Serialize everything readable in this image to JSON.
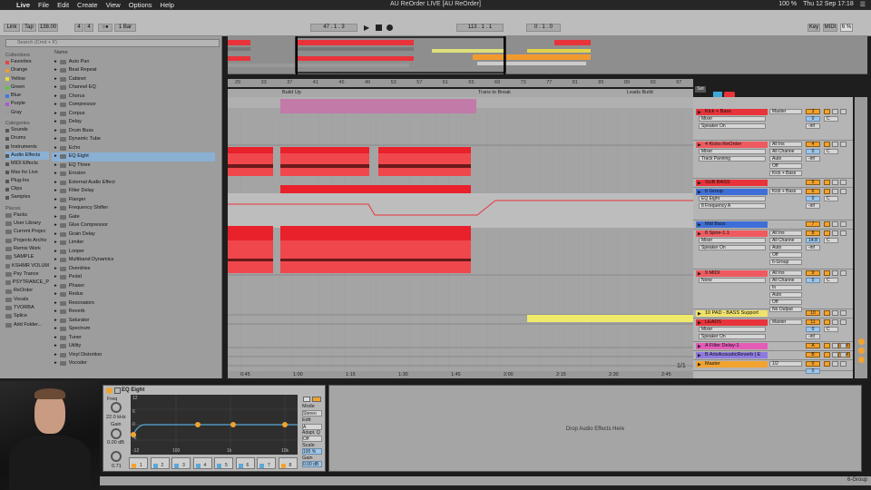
{
  "menubar": {
    "apple": "",
    "app": "Live",
    "items": [
      "File",
      "Edit",
      "Create",
      "View",
      "Options",
      "Help"
    ],
    "title": "AU ReOrder LIVE  [AU ReOrder]",
    "right": {
      "battery": "100 %",
      "clock": "Thu 12 Sep  17:18"
    }
  },
  "transport": {
    "link": "Link",
    "tap": "Tap",
    "tempo": "138.00",
    "sig_num": "4",
    "sig_den": "4",
    "metro": "1 Bar",
    "position": "47 .   1 .   3",
    "loop_start": "113 .   1 .   1",
    "loop_len": "0 .   1 .   0",
    "key": "Key",
    "midi": "MIDI",
    "cpu": "6 %"
  },
  "browser": {
    "search_placeholder": "Search (Cmd + F)",
    "collections_header": "Collections",
    "collections": [
      {
        "label": "Favorites",
        "color": "#e8453c"
      },
      {
        "label": "Orange",
        "color": "#f29a2e"
      },
      {
        "label": "Yellow",
        "color": "#eadb3c"
      },
      {
        "label": "Green",
        "color": "#5cc24a"
      },
      {
        "label": "Blue",
        "color": "#3f7ae0"
      },
      {
        "label": "Purple",
        "color": "#a85bd6"
      },
      {
        "label": "Gray",
        "color": "#9a9a9a"
      }
    ],
    "categories_header": "Categories",
    "categories": [
      "Sounds",
      "Drums",
      "Instruments",
      "Audio Effects",
      "MIDI Effects",
      "Max for Live",
      "Plug-Ins",
      "Clips",
      "Samples"
    ],
    "selected_category": "Audio Effects",
    "places_header": "Places",
    "places": [
      "Packs",
      "User Library",
      "Current Projec",
      "Projects Archiv",
      "Remix Work",
      "SAMPLE",
      "KSHMR VOLUM",
      "Psy Trance",
      "PSYTRANCE_P",
      "ReOrder",
      "Vocals",
      "TVORBA",
      "Splice",
      "Add Folder..."
    ],
    "list_header": "Name",
    "list": [
      "Auto Pan",
      "Beat Repeat",
      "Cabinet",
      "Channel EQ",
      "Chorus",
      "Compressor",
      "Corpus",
      "Delay",
      "Drum Buss",
      "Dynamic Tube",
      "Echo",
      "EQ Eight",
      "EQ Three",
      "Erosion",
      "External Audio Effect",
      "Filter Delay",
      "Flanger",
      "Frequency Shifter",
      "Gate",
      "Glue Compressor",
      "Grain Delay",
      "Limiter",
      "Looper",
      "Multiband Dynamics",
      "Overdrive",
      "Pedal",
      "Phaser",
      "Redux",
      "Resonators",
      "Reverb",
      "Saturator",
      "Spectrum",
      "Tuner",
      "Utility",
      "Vinyl Distortion",
      "Vocoder"
    ],
    "selected_item": "EQ Eight"
  },
  "arrangement": {
    "ruler": [
      "29",
      "33",
      "37",
      "41",
      "45",
      "49",
      "53",
      "57",
      "61",
      "65",
      "69",
      "73",
      "77",
      "81",
      "85",
      "89",
      "93",
      "97"
    ],
    "locators": [
      "Build Up",
      "Trans to Break",
      "Leads Build"
    ],
    "set_label": "Set",
    "time_ruler": [
      "0:45",
      "1:00",
      "1:15",
      "1:30",
      "1:45",
      "2:00",
      "2:15",
      "2:30",
      "2:45"
    ],
    "zoom_label": "1/1"
  },
  "mixer": {
    "tracks": [
      {
        "name": "Kick + Bass",
        "color": "#e8333a",
        "input": "Master",
        "routing": [
          "Mixer",
          "Speaker On"
        ],
        "num": "3",
        "vol": "0",
        "pan": "C",
        "send": "-inf"
      },
      {
        "name": "4 Kicks ReOrder",
        "color": "#ee5a5f",
        "input": "All Ins",
        "routing": [
          "Mixer",
          "Track Panning"
        ],
        "extra": [
          "All Channe",
          "Auto",
          "Off",
          "Kick + Bass"
        ],
        "num": "4",
        "vol": "0",
        "pan": "C",
        "send": "-inf"
      },
      {
        "name": "SUB BASS",
        "color": "#e8333a",
        "num": "5"
      },
      {
        "name": "6 Group",
        "color": "#3e6fd8",
        "input": "Kick + Bass",
        "routing": [
          "EQ Eight",
          "8 Frequency A"
        ],
        "num": "6",
        "vol": "0",
        "pan": "C",
        "send": "-inf"
      },
      {
        "name": "Mid Bass",
        "color": "#3e6fd8",
        "num": "7"
      },
      {
        "name": "8 Spire-1.1",
        "color": "#ee5a5f",
        "input": "All Ins",
        "routing": [
          "Mixer",
          "Speaker On"
        ],
        "extra": [
          "All Channe",
          "Auto",
          "Off",
          "6-Group"
        ],
        "num": "8",
        "vol": "14.8",
        "pan": "C",
        "send": "-inf"
      },
      {
        "name": "9 MIDI",
        "color": "#ee5a5f",
        "input": "All Ins",
        "routing": [
          "None"
        ],
        "extra": [
          "All Channe",
          "In",
          "Auto",
          "Off",
          "No Output"
        ],
        "num": "9",
        "vol": "0",
        "pan": "C"
      },
      {
        "name": "10 PAD - BASS Support",
        "color": "#efe26a",
        "num": "10"
      },
      {
        "name": "LEADS",
        "color": "#e8333a",
        "input": "Master",
        "routing": [
          "Mixer",
          "Speaker On"
        ],
        "num": "11",
        "vol": "0",
        "pan": "C",
        "send": "-inf"
      },
      {
        "name": "A Filter Delay-1",
        "color": "#e45bb8",
        "num": "A",
        "post": "Post"
      },
      {
        "name": "B ArtsAcousticReverb | E",
        "color": "#8f7ae0",
        "num": "B",
        "post": "Post"
      },
      {
        "name": "Master",
        "color": "#f2a22f",
        "input": "1/2",
        "num": "0",
        "vol": "0"
      }
    ]
  },
  "device": {
    "name": "EQ Eight",
    "freq_label": "Freq",
    "freq_value": "22.0 kHz",
    "gain_label": "Gain",
    "gain_value": "0.00 dB",
    "q_value": "0.71",
    "graph_db": [
      "12",
      "6",
      "0",
      "-6",
      "-12"
    ],
    "graph_freq": [
      "100",
      "1k",
      "10k"
    ],
    "mode_label": "Mode",
    "mode_value": "Stereo",
    "edit_label": "Edit",
    "edit_value": "A",
    "adapt_label": "Adapt. Q",
    "adapt_value": "Off",
    "scale_label": "Scale",
    "scale_value": "100 %",
    "gain2_label": "Gain",
    "gain2_value": "0.00 dB",
    "bands": [
      "1",
      "2",
      "3",
      "4",
      "5",
      "6",
      "7",
      "8"
    ],
    "drop_text": "Drop Audio Effects Here"
  },
  "status": {
    "right": "6-Group"
  }
}
